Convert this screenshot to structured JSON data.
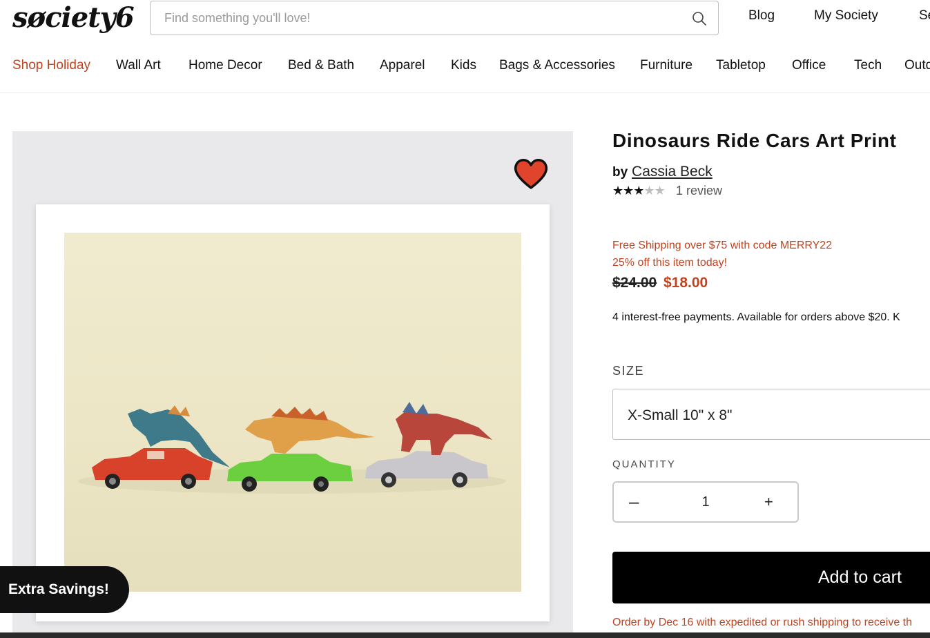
{
  "header": {
    "logo_text": "søciety6",
    "search_placeholder": "Find something you'll love!",
    "links": [
      "Blog",
      "My Society",
      "Se"
    ]
  },
  "nav": {
    "items": [
      "Shop Holiday",
      "Wall Art",
      "Home Decor",
      "Bed & Bath",
      "Apparel",
      "Kids",
      "Bags & Accessories",
      "Furniture",
      "Tabletop",
      "Office",
      "Tech",
      "Outd"
    ],
    "accent_color": "#c0441f"
  },
  "product": {
    "title": "Dinosaurs Ride Cars Art Print",
    "by_prefix": "by",
    "artist": "Cassia Beck",
    "rating": 3,
    "rating_max": 5,
    "reviews": "1 review",
    "promo_shipping": "Free Shipping over $75 with code MERRY22",
    "promo_discount": "25% off this item today!",
    "price_old": "$24.00",
    "price_new": "$18.00",
    "payments": "4 interest-free payments. Available for orders above $20. K",
    "size_label": "SIZE",
    "size_value": "X-Small 10\" x 8\"",
    "quantity_label": "QUANTITY",
    "quantity_value": "1",
    "minus": "–",
    "plus": "+",
    "add_to_cart": "Add to cart",
    "order_note": "Order by Dec 16 with expedited or rush shipping to receive th"
  },
  "favorite_icon": "heart-icon",
  "heart_color": "#e0442c",
  "savings_tab": "Extra Savings!"
}
